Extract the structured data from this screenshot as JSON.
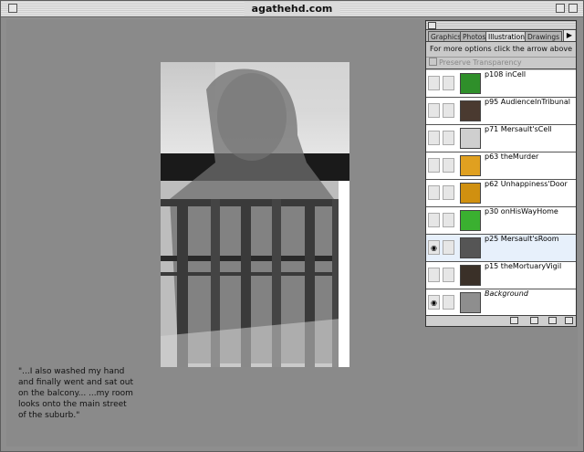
{
  "window": {
    "title": "agathehd.com"
  },
  "palette": {
    "tabs": [
      "Graphics",
      "Photos",
      "Illustrations",
      "Drawings"
    ],
    "active_tab": "Illustrations",
    "options_text": "For more options click the arrow above",
    "preserve_transparency": "Preserve Transparency",
    "layers": [
      {
        "name": "p108 inCell",
        "visible": false,
        "thumb_color": "#2f8f2a"
      },
      {
        "name": "p95 AudienceInTribunal",
        "visible": false,
        "thumb_color": "#4a3a30"
      },
      {
        "name": "p71 Mersault'sCell",
        "visible": false,
        "thumb_color": "#cfcfcf"
      },
      {
        "name": "p63 theMurder",
        "visible": false,
        "thumb_color": "#e0a020"
      },
      {
        "name": "p62 Unhappiness'Door",
        "visible": false,
        "thumb_color": "#d09010"
      },
      {
        "name": "p30 onHisWayHome",
        "visible": false,
        "thumb_color": "#3ab030"
      },
      {
        "name": "p25 Mersault'sRoom",
        "visible": true,
        "thumb_color": "#555555"
      },
      {
        "name": "p15 theMortuaryVigil",
        "visible": false,
        "thumb_color": "#3a3028"
      },
      {
        "name": "Background",
        "visible": true,
        "thumb_color": "#8e8e8e"
      }
    ]
  },
  "quote": {
    "lines": [
      "\"...I also washed my hand",
      "and finally went and sat out",
      "on the balcony... ...my room",
      "looks onto the main street",
      "of the suburb.\""
    ]
  },
  "icons": {
    "eye": "eye-icon",
    "arrow": "triangle-right-icon",
    "new_layer": "new-layer-icon",
    "trash": "trash-icon",
    "mask": "mask-icon"
  }
}
